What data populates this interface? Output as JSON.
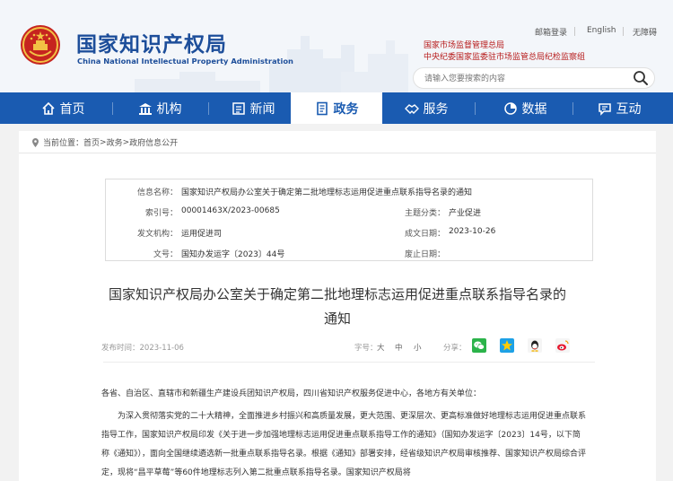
{
  "header": {
    "title_cn": "国家知识产权局",
    "title_en": "China National Intellectual Property Administration",
    "links": [
      "邮箱登录",
      "English",
      "无障碍"
    ],
    "related": [
      "国家市场监督管理总局",
      "中央纪委国家监委驻市场监管总局纪检监察组"
    ],
    "search_placeholder": "请输入您要搜索的内容"
  },
  "nav": {
    "items": [
      {
        "label": "首页",
        "icon": "home-icon"
      },
      {
        "label": "机构",
        "icon": "institution-icon"
      },
      {
        "label": "新闻",
        "icon": "newspaper-icon"
      },
      {
        "label": "政务",
        "icon": "document-icon",
        "active": true
      },
      {
        "label": "服务",
        "icon": "handshake-icon"
      },
      {
        "label": "数据",
        "icon": "chart-icon"
      },
      {
        "label": "互动",
        "icon": "chat-icon"
      }
    ]
  },
  "breadcrumb": {
    "prefix": "当前位置：",
    "items": [
      "首页",
      "政务",
      "政府信息公开"
    ],
    "separator": ">"
  },
  "info": {
    "info_name_label": "信息名称：",
    "info_name_value": "国家知识产权局办公室关于确定第二批地理标志运用促进重点联系指导名录的通知",
    "index_label": "索引号：",
    "index_value": "00001463X/2023-00685",
    "topic_label": "主题分类：",
    "topic_value": "产业促进",
    "issuer_label": "发文机构：",
    "issuer_value": "运用促进司",
    "date_label": "成文日期：",
    "date_value": "2023-10-26",
    "docno_label": "文号：",
    "docno_value": "国知办发运字〔2023〕44号",
    "abolish_label": "废止日期：",
    "abolish_value": ""
  },
  "article": {
    "title_line1": "国家知识产权局办公室关于确定第二批地理标志运用促进重点联系指导名录的",
    "title_line2": "通知",
    "publish_date": "发布时间：2023-11-06",
    "size_label": "字号：",
    "size_options": [
      "大",
      "中",
      "小"
    ],
    "share_label": "分享：",
    "share_icons": [
      "wechat-icon",
      "qzone-icon",
      "qq-icon",
      "weibo-icon"
    ],
    "salutation": "各省、自治区、直辖市和新疆生产建设兵团知识产权局，四川省知识产权服务促进中心，各地方有关单位：",
    "paragraph": "为深入贯彻落实党的二十大精神，全面推进乡村振兴和高质量发展，更大范围、更深层次、更高标准做好地理标志运用促进重点联系指导工作，国家知识产权局印发《关于进一步加强地理标志运用促进重点联系指导工作的通知》（国知办发运字〔2023〕14号，以下简称《通知》），面向全国继续遴选新一批重点联系指导名录。根据《通知》部署安排，经省级知识产权局审核推荐、国家知识产权局综合评定，现将“昌平草莓”等60件地理标志列入第二批重点联系指导名录。国家知识产权局将"
  },
  "colors": {
    "brand_blue": "#1a5bb1",
    "title_blue": "#1d4e9a",
    "red": "#b71c1c"
  }
}
